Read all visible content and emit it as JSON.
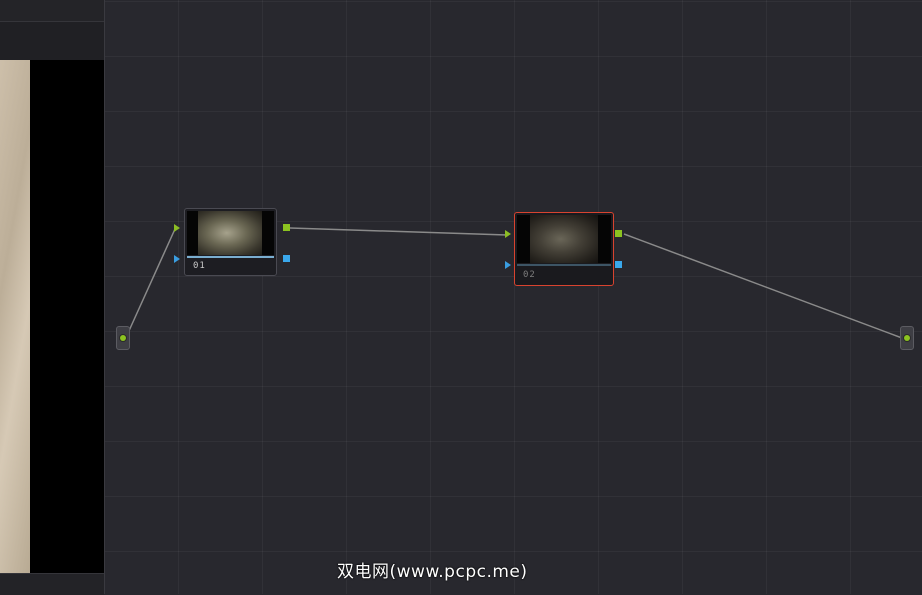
{
  "nodes": [
    {
      "label": "01",
      "selected": false
    },
    {
      "label": "02",
      "selected": true
    }
  ],
  "colors": {
    "editor_background": "#28282e",
    "selected_border": "#d8432f",
    "rgb_port": "#8cc320",
    "key_port": "#3aa8ec",
    "link": "#8a8a8a"
  },
  "watermark": "双电网(www.pcpc.me)"
}
